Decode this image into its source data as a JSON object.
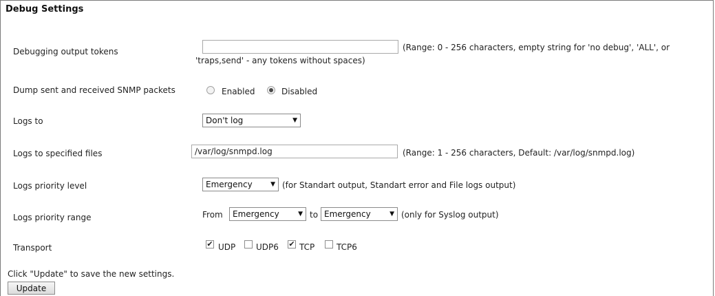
{
  "section": {
    "title": "Debug Settings"
  },
  "debug_tokens": {
    "label": "Debugging output tokens",
    "value": "",
    "hint_line1": "(Range: 0 - 256 characters, empty string for 'no debug', 'ALL', or",
    "hint_line2": "'traps,send' - any tokens without spaces)"
  },
  "dump_packets": {
    "label": "Dump sent and received SNMP packets",
    "options": [
      "Enabled",
      "Disabled"
    ],
    "selected": "Disabled"
  },
  "logs_to": {
    "label": "Logs to",
    "selected": "Don't log"
  },
  "log_files": {
    "label": "Logs to specified files",
    "value": "/var/log/snmpd.log",
    "hint": "(Range: 1 - 256 characters, Default: /var/log/snmpd.log)"
  },
  "priority_level": {
    "label": "Logs priority level",
    "selected": "Emergency",
    "hint": "(for Standart output, Standart error and File logs output)"
  },
  "priority_range": {
    "label": "Logs priority range",
    "from_label": "From",
    "from_selected": "Emergency",
    "to_label": "to",
    "to_selected": "Emergency",
    "hint": "(only for Syslog output)"
  },
  "transport": {
    "label": "Transport",
    "options": [
      {
        "name": "UDP",
        "checked": true
      },
      {
        "name": "UDP6",
        "checked": false
      },
      {
        "name": "TCP",
        "checked": true
      },
      {
        "name": "TCP6",
        "checked": false
      }
    ]
  },
  "footer": {
    "note": "Click \"Update\" to save the new settings.",
    "update_label": "Update"
  }
}
